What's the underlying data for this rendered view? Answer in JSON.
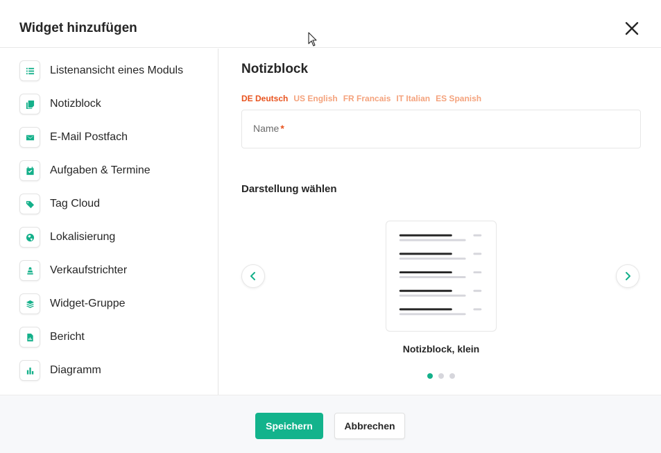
{
  "dialog": {
    "title": "Widget hinzufügen"
  },
  "sidebar": {
    "items": [
      {
        "label": "Listenansicht eines Moduls",
        "icon": "list-icon"
      },
      {
        "label": "Notizblock",
        "icon": "notes-icon"
      },
      {
        "label": "E-Mail Postfach",
        "icon": "envelope-icon"
      },
      {
        "label": "Aufgaben & Termine",
        "icon": "calendar-check-icon"
      },
      {
        "label": "Tag Cloud",
        "icon": "tags-icon"
      },
      {
        "label": "Lokalisierung",
        "icon": "globe-icon"
      },
      {
        "label": "Verkaufstrichter",
        "icon": "funnel-pyramid-icon"
      },
      {
        "label": "Widget-Gruppe",
        "icon": "layers-icon"
      },
      {
        "label": "Bericht",
        "icon": "report-file-icon"
      },
      {
        "label": "Diagramm",
        "icon": "bar-chart-icon"
      }
    ]
  },
  "panel": {
    "title": "Notizblock",
    "languages": [
      {
        "label": "DE Deutsch",
        "active": true
      },
      {
        "label": "US English",
        "active": false
      },
      {
        "label": "FR Francais",
        "active": false
      },
      {
        "label": "IT Italian",
        "active": false
      },
      {
        "label": "ES Spanish",
        "active": false
      }
    ],
    "name_field": {
      "label": "Name",
      "required_mark": "*",
      "value": ""
    },
    "section_title": "Darstellung wählen",
    "carousel": {
      "current_caption": "Notizblock, klein",
      "page_count": 3,
      "active_page": 1
    }
  },
  "footer": {
    "save_label": "Speichern",
    "cancel_label": "Abbrechen"
  },
  "colors": {
    "accent": "#13b38c",
    "lang_active": "#e8531e",
    "lang_inactive": "#f4a27c",
    "text": "#262626"
  }
}
